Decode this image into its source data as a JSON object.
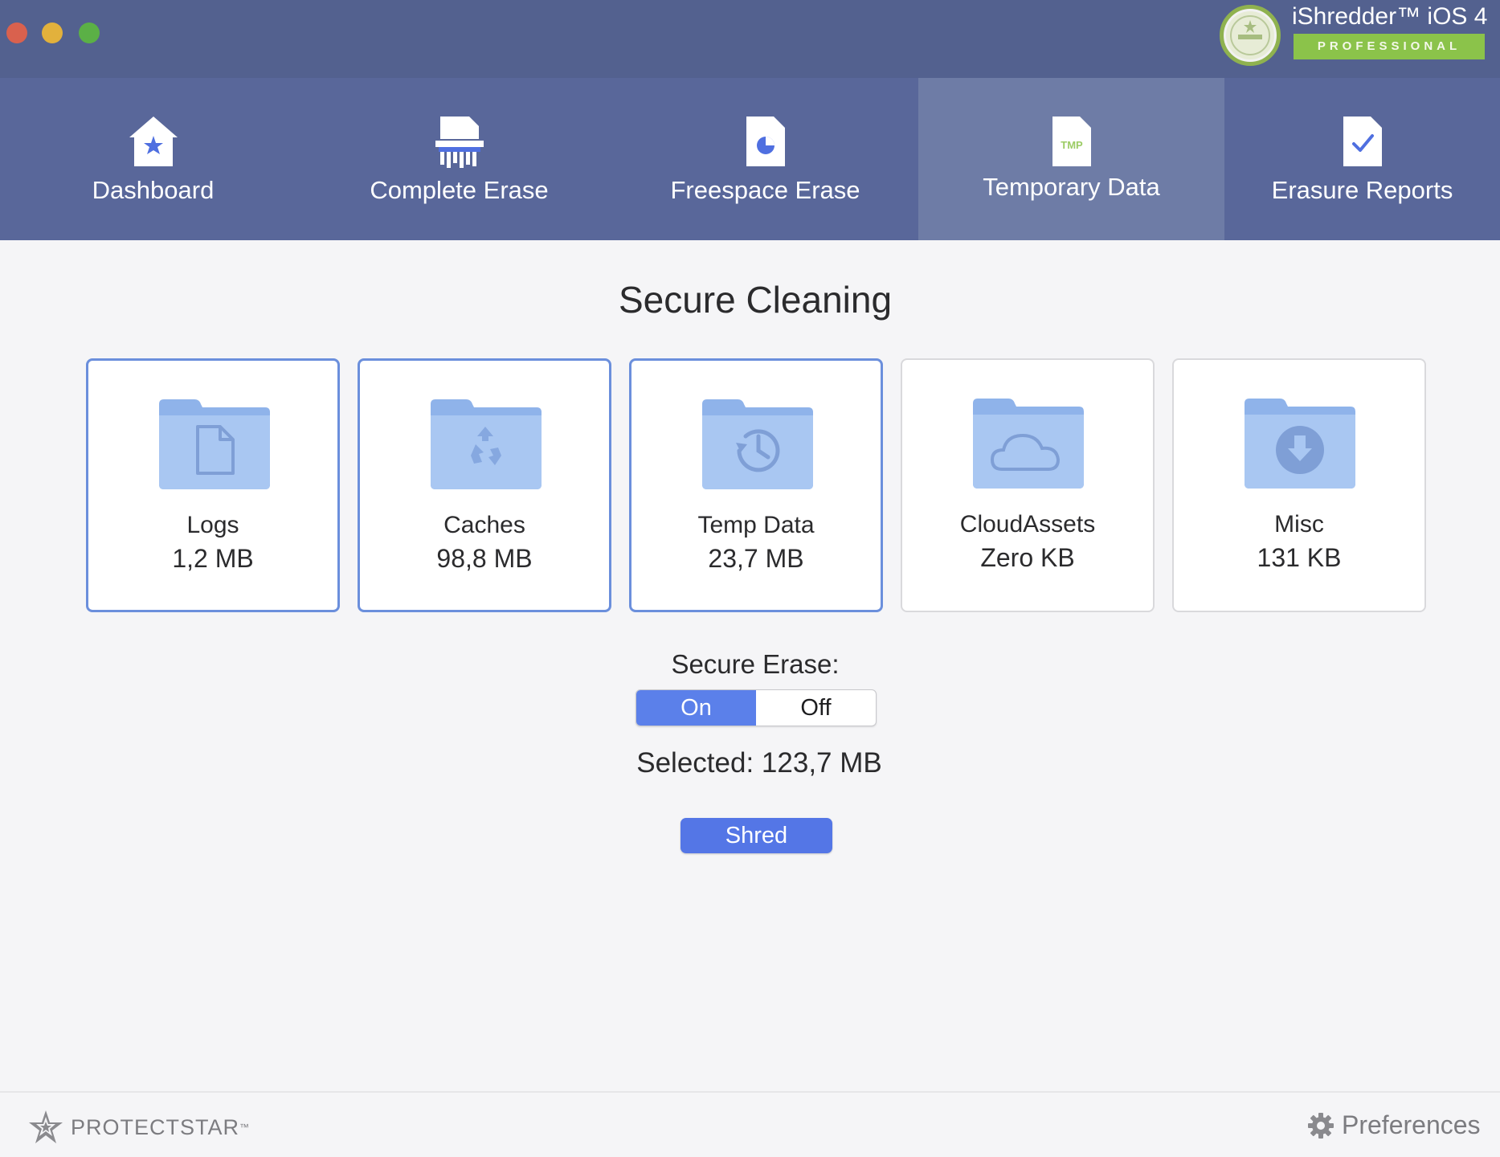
{
  "window": {
    "app_name": "iShredder™ iOS 4",
    "edition": "PROFESSIONAL",
    "colors": {
      "titlebar": "#53618f",
      "toolbar": "#59679a",
      "active_tab": "#6e7ca6",
      "accent": "#5b80ea",
      "edition": "#8bc34a"
    }
  },
  "tabs": [
    {
      "label": "Dashboard",
      "icon": "home-star-icon"
    },
    {
      "label": "Complete Erase",
      "icon": "shredder-icon"
    },
    {
      "label": "Freespace Erase",
      "icon": "pie-document-icon"
    },
    {
      "label": "Temporary Data",
      "icon": "tmp-document-icon",
      "active": true,
      "icon_text": "TMP"
    },
    {
      "label": "Erasure Reports",
      "icon": "check-document-icon"
    }
  ],
  "main": {
    "title": "Secure Cleaning",
    "cards": [
      {
        "name": "Logs",
        "size": "1,2 MB",
        "icon": "document-folder-icon",
        "selected": true
      },
      {
        "name": "Caches",
        "size": "98,8 MB",
        "icon": "recycle-folder-icon",
        "selected": true
      },
      {
        "name": "Temp Data",
        "size": "23,7 MB",
        "icon": "history-folder-icon",
        "selected": true
      },
      {
        "name": "CloudAssets",
        "size": "Zero KB",
        "icon": "cloud-folder-icon",
        "selected": false
      },
      {
        "name": "Misc",
        "size": "131 KB",
        "icon": "download-folder-icon",
        "selected": false
      }
    ],
    "secure_erase_label": "Secure Erase:",
    "toggle": {
      "on": "On",
      "off": "Off",
      "value": "On"
    },
    "selected_label": "Selected:",
    "selected_value": "123,7 MB",
    "shred_button": "Shred"
  },
  "footer": {
    "brand": "PROTECTSTAR",
    "brand_tm": "™",
    "preferences": "Preferences"
  }
}
